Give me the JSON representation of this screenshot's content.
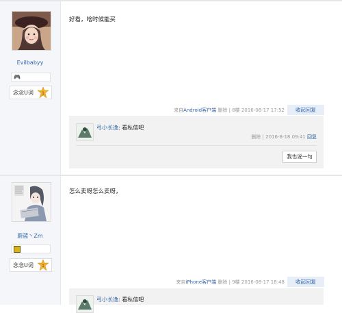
{
  "posts": [
    {
      "username": "Evilbabyy",
      "level_label": "念念U词",
      "content": "好看，啥时候能买",
      "meta": {
        "source_prefix": "来自",
        "source": "Android客户端",
        "delete": "删除",
        "sep": "|",
        "floor": "8楼",
        "time": "2016-08-17 17:52"
      },
      "collapse_label": "收起回复",
      "replies": [
        {
          "author": "弓小长逸",
          "colon": ":",
          "text": "看私信吧",
          "delete": "删除",
          "sep": "|",
          "time": "2016-8-18 09:41",
          "reply": "回复"
        }
      ],
      "say_label": "我也说一句"
    },
    {
      "username": "蔚蓝丶Zm",
      "level_label": "念念U词",
      "content": "怎么卖呀怎么卖呀，",
      "meta": {
        "source_prefix": "来自",
        "source": "iPhone客户端",
        "delete": "删除",
        "sep": "|",
        "floor": "9楼",
        "time": "2016-08-17 18:48"
      },
      "collapse_label": "收起回复",
      "replies": [
        {
          "author": "弓小长逸",
          "colon": ":",
          "text": "看私信吧"
        }
      ]
    }
  ],
  "colors": {
    "link": "#3366aa",
    "sidebar": "#f4f6fa",
    "lzl_bg": "#f2f2f2",
    "meta": "#999999"
  }
}
